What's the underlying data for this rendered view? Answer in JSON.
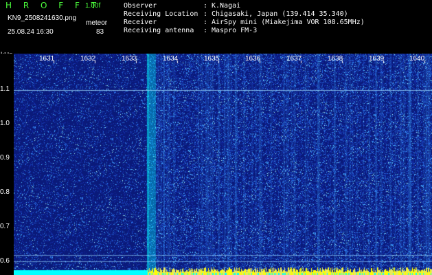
{
  "header": {
    "brand": "H R O F F T",
    "version": "1.00f",
    "filename": "KN9_2508241630.png",
    "timestamp": "25.08.24 16:30",
    "meteor_label": "meteor",
    "meteor_count": "83"
  },
  "info": [
    {
      "key": "Observer",
      "value": "K.Nagai"
    },
    {
      "key": "Receiving Location",
      "value": "Chigasaki, Japan (139.414 35.340)"
    },
    {
      "key": "Receiver",
      "value": "AirSpy mini (Miakejima VOR 108.65MHz)"
    },
    {
      "key": "Receiving antenna",
      "value": "Maspro FM-3"
    }
  ],
  "separator": ":",
  "y_axis": {
    "unit": "kHz",
    "ticks": [
      "1.1",
      "1.0",
      "0.9",
      "0.8",
      "0.7",
      "0.6"
    ]
  },
  "x_axis": {
    "ticks": [
      "1631",
      "1632",
      "1633",
      "1634",
      "1635",
      "1636",
      "1637",
      "1638",
      "1639",
      "1640"
    ]
  },
  "colors": {
    "background": "#0a1a7a",
    "noise_low": "#1530b0",
    "noise_high": "#3fa0ff",
    "signal": "#00ffff",
    "level_bar": "#ffff00",
    "text_green": "#4cff3c"
  }
}
